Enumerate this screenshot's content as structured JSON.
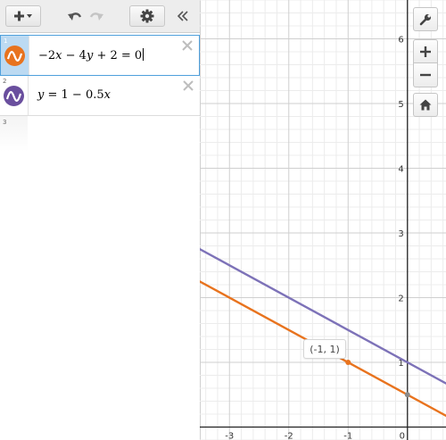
{
  "toolbar": {
    "add_icon": "plus-icon",
    "undo_icon": "undo-icon",
    "redo_icon": "redo-icon",
    "settings_icon": "gear-icon",
    "collapse_icon": "double-chevron-left-icon"
  },
  "expressions": [
    {
      "index": "1",
      "latex_display": [
        "−2",
        "x",
        " − 4",
        "y",
        " + 2 = 0"
      ],
      "color": "#e8731e",
      "selected": true
    },
    {
      "index": "2",
      "latex_display": [
        "y",
        " = 1 − 0.5",
        "x"
      ],
      "color": "#6a4f9e",
      "selected": false
    },
    {
      "index": "3"
    }
  ],
  "graph": {
    "x_ticks": [
      "-3",
      "-2",
      "-1",
      "0"
    ],
    "y_ticks": [
      "1",
      "2",
      "3",
      "4",
      "5",
      "6"
    ],
    "point_label": "(-1, 1)",
    "colors": {
      "grid_minor": "#ececec",
      "grid_major": "#cfcfcf",
      "axis": "#222222"
    }
  },
  "chart_data": {
    "type": "line",
    "series": [
      {
        "name": "−2x − 4y + 2 = 0",
        "x": [
          -3.5,
          0.65
        ],
        "y": [
          2.25,
          0.175
        ],
        "color": "#e8731e"
      },
      {
        "name": "y = 1 − 0.5x",
        "x": [
          -3.5,
          0.65
        ],
        "y": [
          2.75,
          0.675
        ],
        "color": "#7d72b8"
      }
    ],
    "points": [
      {
        "x": -1,
        "y": 1,
        "label": "(-1, 1)",
        "color": "#e8731e"
      },
      {
        "x": 0,
        "y": 0.5,
        "color": "#8a8a8a"
      }
    ],
    "xlim": [
      -3.5,
      0.65
    ],
    "ylim": [
      -0.2,
      6.6
    ],
    "grid": true
  },
  "side_controls": {
    "settings_icon": "wrench-icon",
    "zoom_in_icon": "plus-icon",
    "zoom_out_icon": "minus-icon",
    "home_icon": "home-icon"
  }
}
